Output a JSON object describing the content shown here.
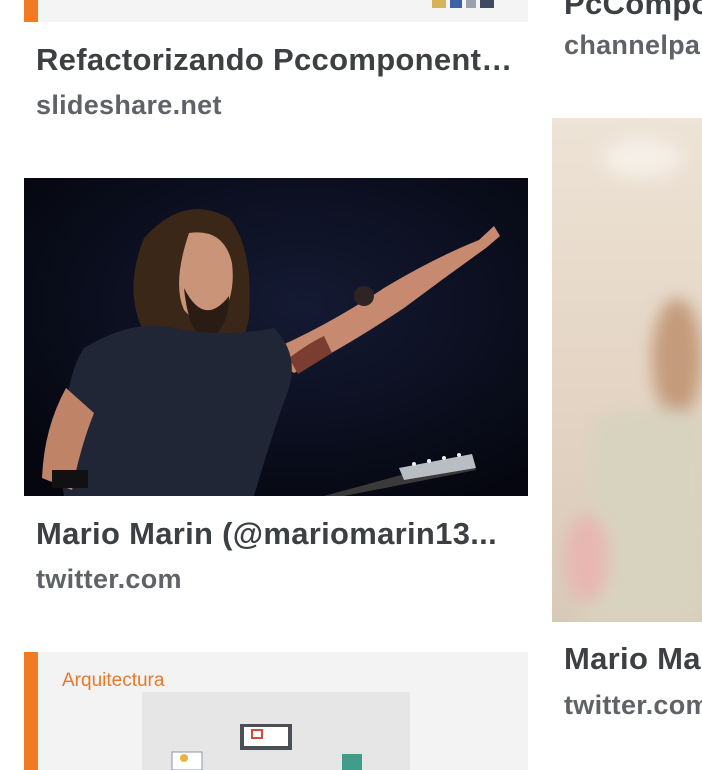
{
  "results": [
    {
      "title": "Refactorizando Pccomponentes...",
      "source": "slideshare.net"
    },
    {
      "title": "PcCompo",
      "source": "channelpa"
    },
    {
      "title": "Mario Marin (@mariomarin13...",
      "source": "twitter.com"
    },
    {
      "title": "Mario Ma",
      "source": "twitter.com"
    },
    {
      "slide_heading": "Arquitectura"
    }
  ],
  "colors": {
    "accent": "#f07b22",
    "title_text": "#3c4043",
    "source_text": "#5f6368"
  }
}
